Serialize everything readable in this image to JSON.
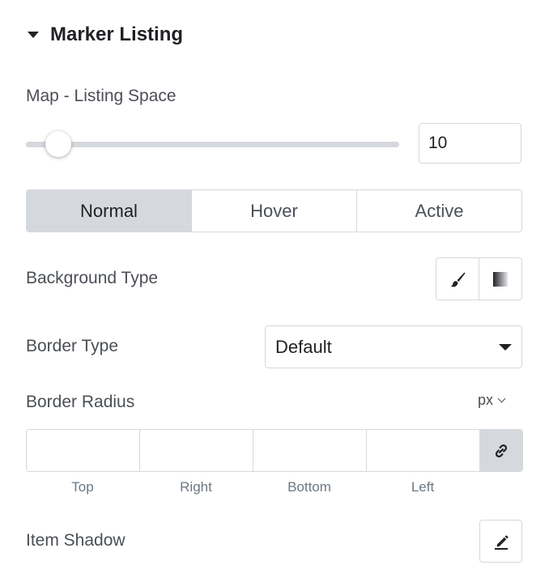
{
  "section": {
    "title": "Marker Listing",
    "expanded": true,
    "icon": "caret-down-icon"
  },
  "listing_space": {
    "label": "Map - Listing Space",
    "value": "10",
    "slider_fraction": 0.09
  },
  "state_tabs": [
    {
      "label": "Normal",
      "active": true
    },
    {
      "label": "Hover",
      "active": false
    },
    {
      "label": "Active",
      "active": false
    }
  ],
  "background_type": {
    "label": "Background Type",
    "options": [
      "brush-icon",
      "gradient-icon"
    ]
  },
  "border_type": {
    "label": "Border Type",
    "value": "Default"
  },
  "border_radius": {
    "label": "Border Radius",
    "unit": "px",
    "fields": [
      {
        "label": "Top",
        "value": ""
      },
      {
        "label": "Right",
        "value": ""
      },
      {
        "label": "Bottom",
        "value": ""
      },
      {
        "label": "Left",
        "value": ""
      }
    ],
    "link_icon": "link-icon"
  },
  "item_shadow": {
    "label": "Item Shadow",
    "icon": "pencil-icon"
  },
  "colors": {
    "border": "#d5d8dc",
    "active_tab": "#d5d8dc",
    "text": "#1f2124",
    "muted": "#6d7882"
  }
}
